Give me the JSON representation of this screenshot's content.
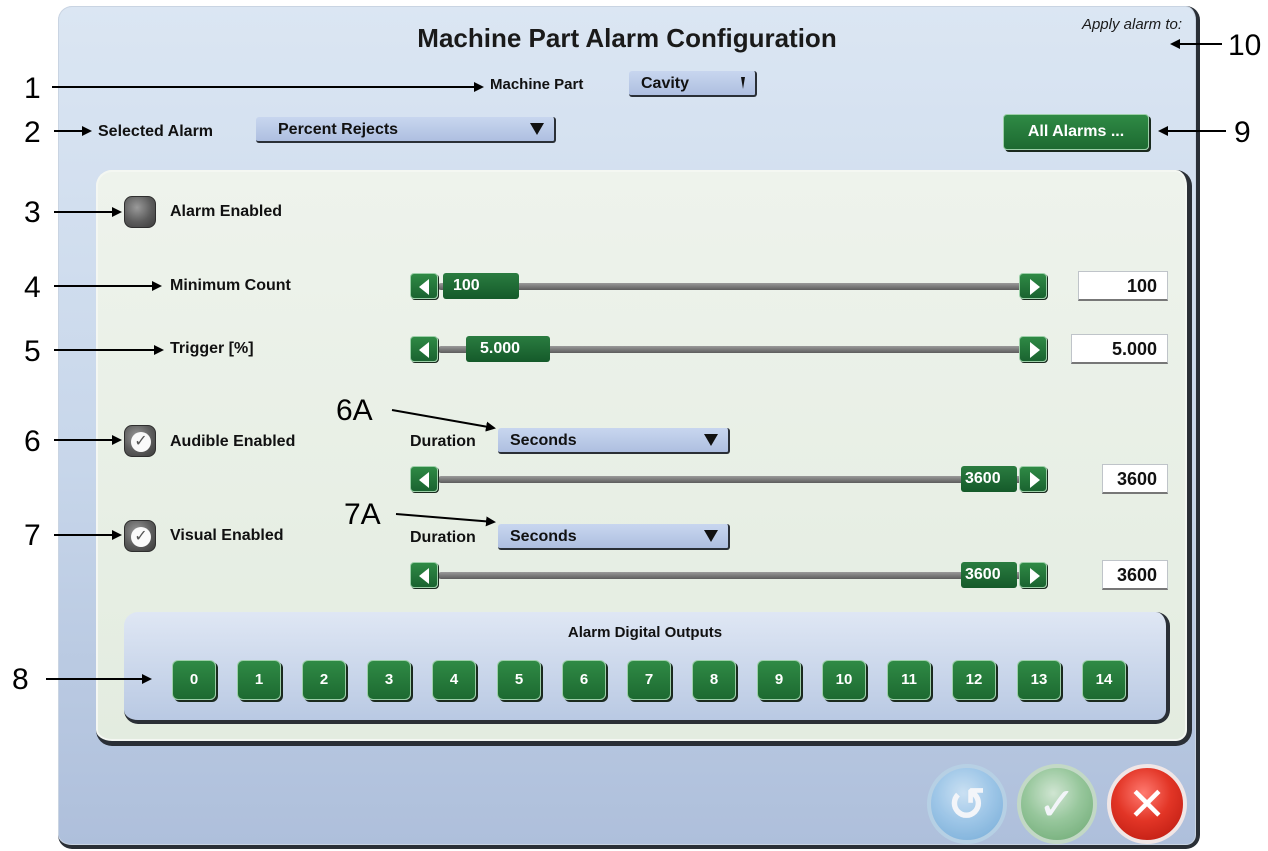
{
  "window": {
    "title": "Machine Part Alarm Configuration",
    "apply_label": "Apply alarm to:"
  },
  "machine_part": {
    "label": "Machine Part",
    "value": "Cavity"
  },
  "selected_alarm": {
    "label": "Selected Alarm",
    "value": "Percent Rejects"
  },
  "all_alarms_button": "All Alarms ...",
  "alarm_enabled": {
    "label": "Alarm Enabled",
    "checked": false
  },
  "minimum_count": {
    "label": "Minimum Count",
    "thumb": "100",
    "value": "100",
    "level": 0.0
  },
  "trigger": {
    "label": "Trigger [%]",
    "thumb": "5.000",
    "value": "5.000",
    "level": 0.0
  },
  "audible": {
    "label": "Audible Enabled",
    "checked": true,
    "duration_label": "Duration",
    "duration_unit": "Seconds",
    "thumb": "3600",
    "value": "3600",
    "level": 1.0
  },
  "visual": {
    "label": "Visual Enabled",
    "checked": true,
    "duration_label": "Duration",
    "duration_unit": "Seconds",
    "thumb": "3600",
    "value": "3600",
    "level": 1.0
  },
  "digital_outputs": {
    "label": "Alarm Digital Outputs",
    "items": [
      "0",
      "1",
      "2",
      "3",
      "4",
      "5",
      "6",
      "7",
      "8",
      "9",
      "10",
      "11",
      "12",
      "13",
      "14"
    ]
  },
  "footer": {
    "undo_icon": "undo-icon",
    "ok_icon": "checkmark-icon",
    "cancel_icon": "x-icon"
  },
  "callouts": {
    "c1": "1",
    "c2": "2",
    "c3": "3",
    "c4": "4",
    "c5": "5",
    "c6": "6",
    "c7": "7",
    "c8": "8",
    "c9": "9",
    "c10": "10",
    "c6a": "6A",
    "c7a": "7A"
  },
  "colors": {
    "accent_green": "#1d6a31",
    "panel_blue": "#c7d6ea",
    "cancel_red": "#e23526"
  }
}
